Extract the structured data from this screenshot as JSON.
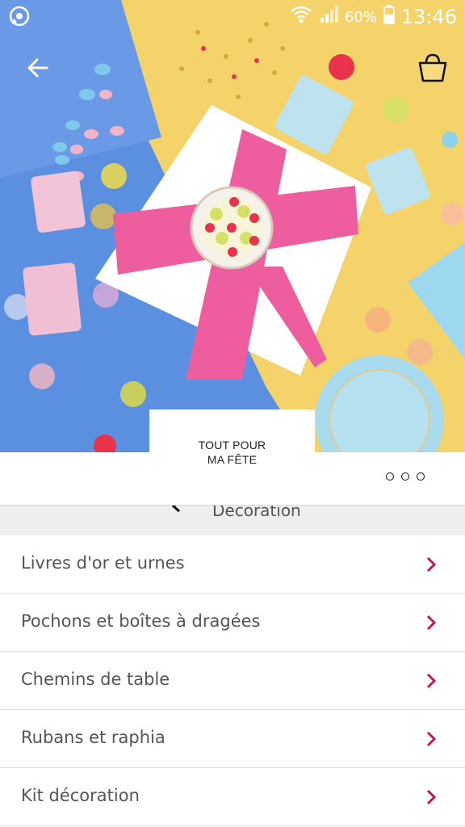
{
  "status_bar": {
    "battery_percent": "60%",
    "time": "13:46"
  },
  "hero": {
    "caption_line1": "TOUT POUR",
    "caption_line2": "MA FÊTE",
    "back_icon": "arrow-left-icon",
    "bag_icon": "shopping-bag-icon"
  },
  "category": {
    "title": "Décoration"
  },
  "list": [
    {
      "label": "Livres d'or et urnes"
    },
    {
      "label": "Pochons et boîtes à dragées"
    },
    {
      "label": "Chemins de table"
    },
    {
      "label": "Rubans et raphia"
    },
    {
      "label": "Kit décoration"
    }
  ],
  "colors": {
    "accent": "#c2185b",
    "hero_blue": "#5b8fe0",
    "hero_yellow": "#f4d46a",
    "ribbon_pink": "#ee5d9e"
  }
}
